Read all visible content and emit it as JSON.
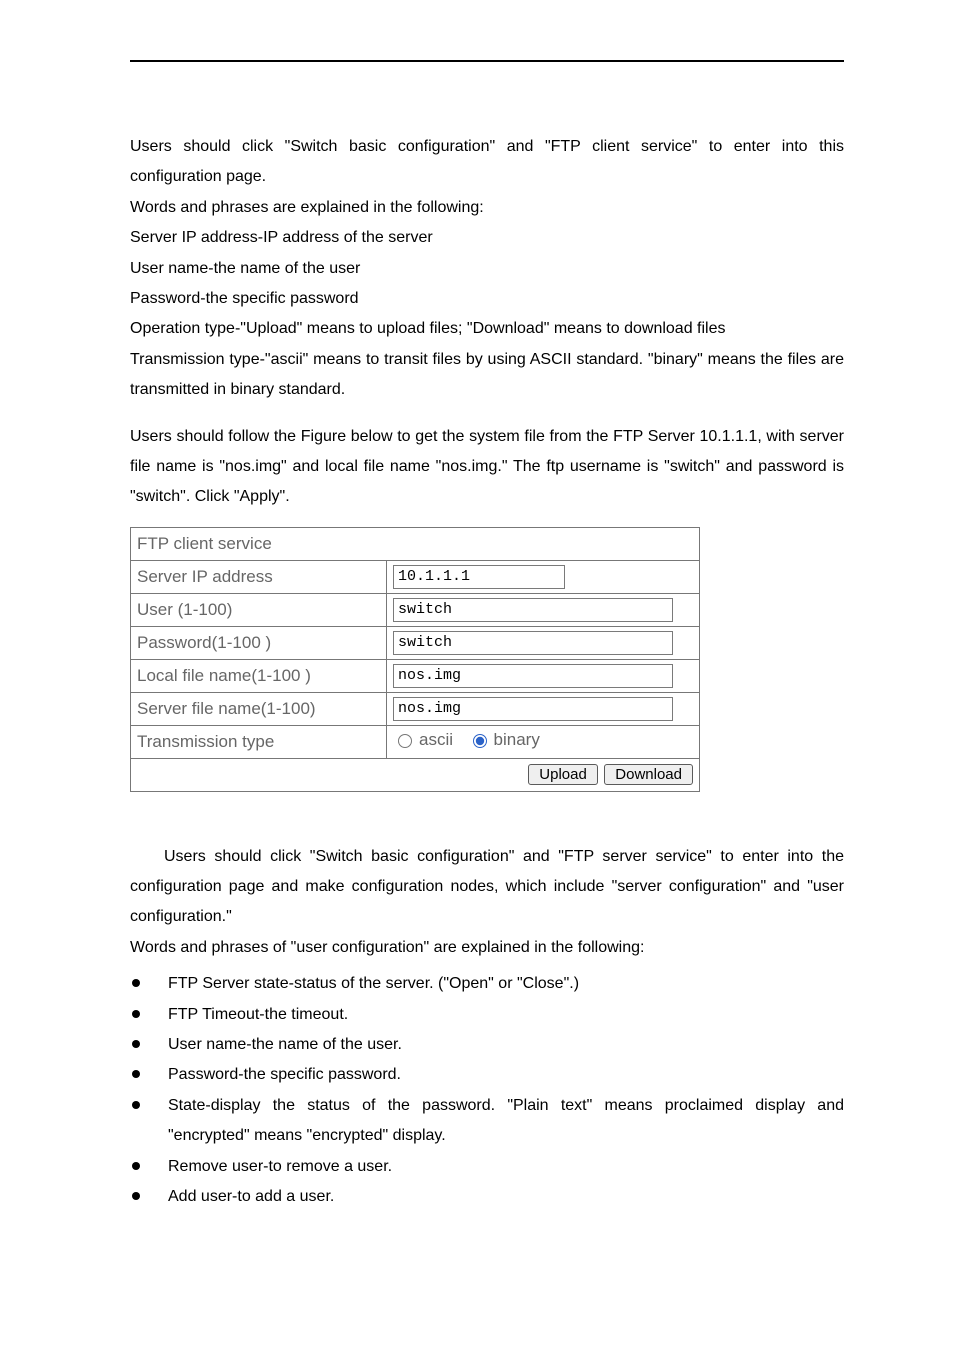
{
  "intro": {
    "p1": "Users should click \"Switch basic configuration\" and \"FTP client service\" to enter into this configuration page.",
    "p2": "Words and phrases are explained in the following:",
    "p3": "Server IP address-IP address of the server",
    "p4": "User name-the name of the user",
    "p5": "Password-the specific password",
    "p6": "Operation type-\"Upload\" means to upload files; \"Download\" means to download files",
    "p7": "Transmission type-\"ascii\" means to transit files by using ASCII standard. \"binary\" means the files are transmitted in binary standard.",
    "p8": "Users should follow the Figure below to get the system file from the FTP Server 10.1.1.1, with server file name is \"nos.img\" and local file name \"nos.img.\" The ftp username is \"switch\" and password is \"switch\". Click \"Apply\"."
  },
  "form": {
    "title": "FTP client service",
    "labels": {
      "server_ip": "Server IP address",
      "user": "User (1-100)",
      "password": "Password(1-100 )",
      "local_file": "Local file name(1-100 )",
      "server_file": "Server file name(1-100)",
      "transmission": "Transmission type"
    },
    "values": {
      "server_ip": "10.1.1.1",
      "user": "switch",
      "password": "switch",
      "local_file": "nos.img",
      "server_file": "nos.img"
    },
    "radio": {
      "ascii": "ascii",
      "binary": "binary"
    },
    "buttons": {
      "upload": "Upload",
      "download": "Download"
    }
  },
  "after": {
    "p1": "Users should click \"Switch basic configuration\" and \"FTP server service\" to enter into the configuration page and make configuration nodes, which include \"server configuration\" and \"user configuration.\"",
    "p2": "Words and phrases of \"user configuration\" are explained in the following:"
  },
  "bullets": {
    "b1": "FTP Server state-status of the server. (\"Open\" or \"Close\".)",
    "b2": "FTP Timeout-the timeout.",
    "b3": "User name-the name of the user.",
    "b4": "Password-the specific password.",
    "b5": "State-display the status of the password. \"Plain text\" means proclaimed display and \"encrypted\" means \"encrypted\" display.",
    "b6": "Remove user-to remove a user.",
    "b7": "Add user-to add a user."
  }
}
